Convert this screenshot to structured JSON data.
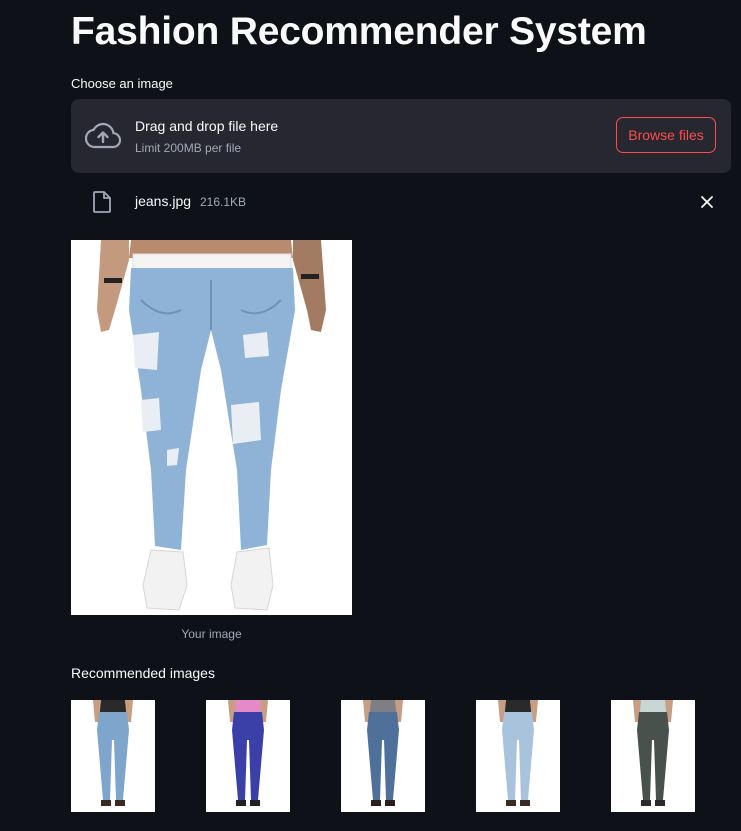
{
  "app": {
    "title": "Fashion Recommender System"
  },
  "uploader": {
    "label": "Choose an image",
    "drop_text": "Drag and drop file here",
    "limit_text": "Limit 200MB per file",
    "browse_label": "Browse files",
    "icon": "cloud-upload-icon"
  },
  "uploaded_file": {
    "name": "jeans.jpg",
    "size": "216.1KB",
    "icon": "file-icon",
    "remove_icon": "close-icon"
  },
  "main_image": {
    "caption": "Your image",
    "subject": "ripped light-blue skinny jeans with white sneakers"
  },
  "recommendations": {
    "heading": "Recommended images",
    "items": [
      {
        "jeans_color": "#7ea6cc",
        "top_color": "#2a2a2a",
        "shoe_color": "#3b2a22"
      },
      {
        "jeans_color": "#3b3fa8",
        "top_color": "#e58ac8",
        "shoe_color": "#222222"
      },
      {
        "jeans_color": "#4f7199",
        "top_color": "#7e7e84",
        "shoe_color": "#2a1f1a"
      },
      {
        "jeans_color": "#a9c3dd",
        "top_color": "#2a2a2a",
        "shoe_color": "#3b2a22"
      },
      {
        "jeans_color": "#48514c",
        "top_color": "#c9d6d6",
        "shoe_color": "#2b2b2b"
      }
    ]
  },
  "colors": {
    "background": "#0e1117",
    "panel": "#262730",
    "accent": "#ff4b4b",
    "muted_text": "#a3a8b8"
  }
}
